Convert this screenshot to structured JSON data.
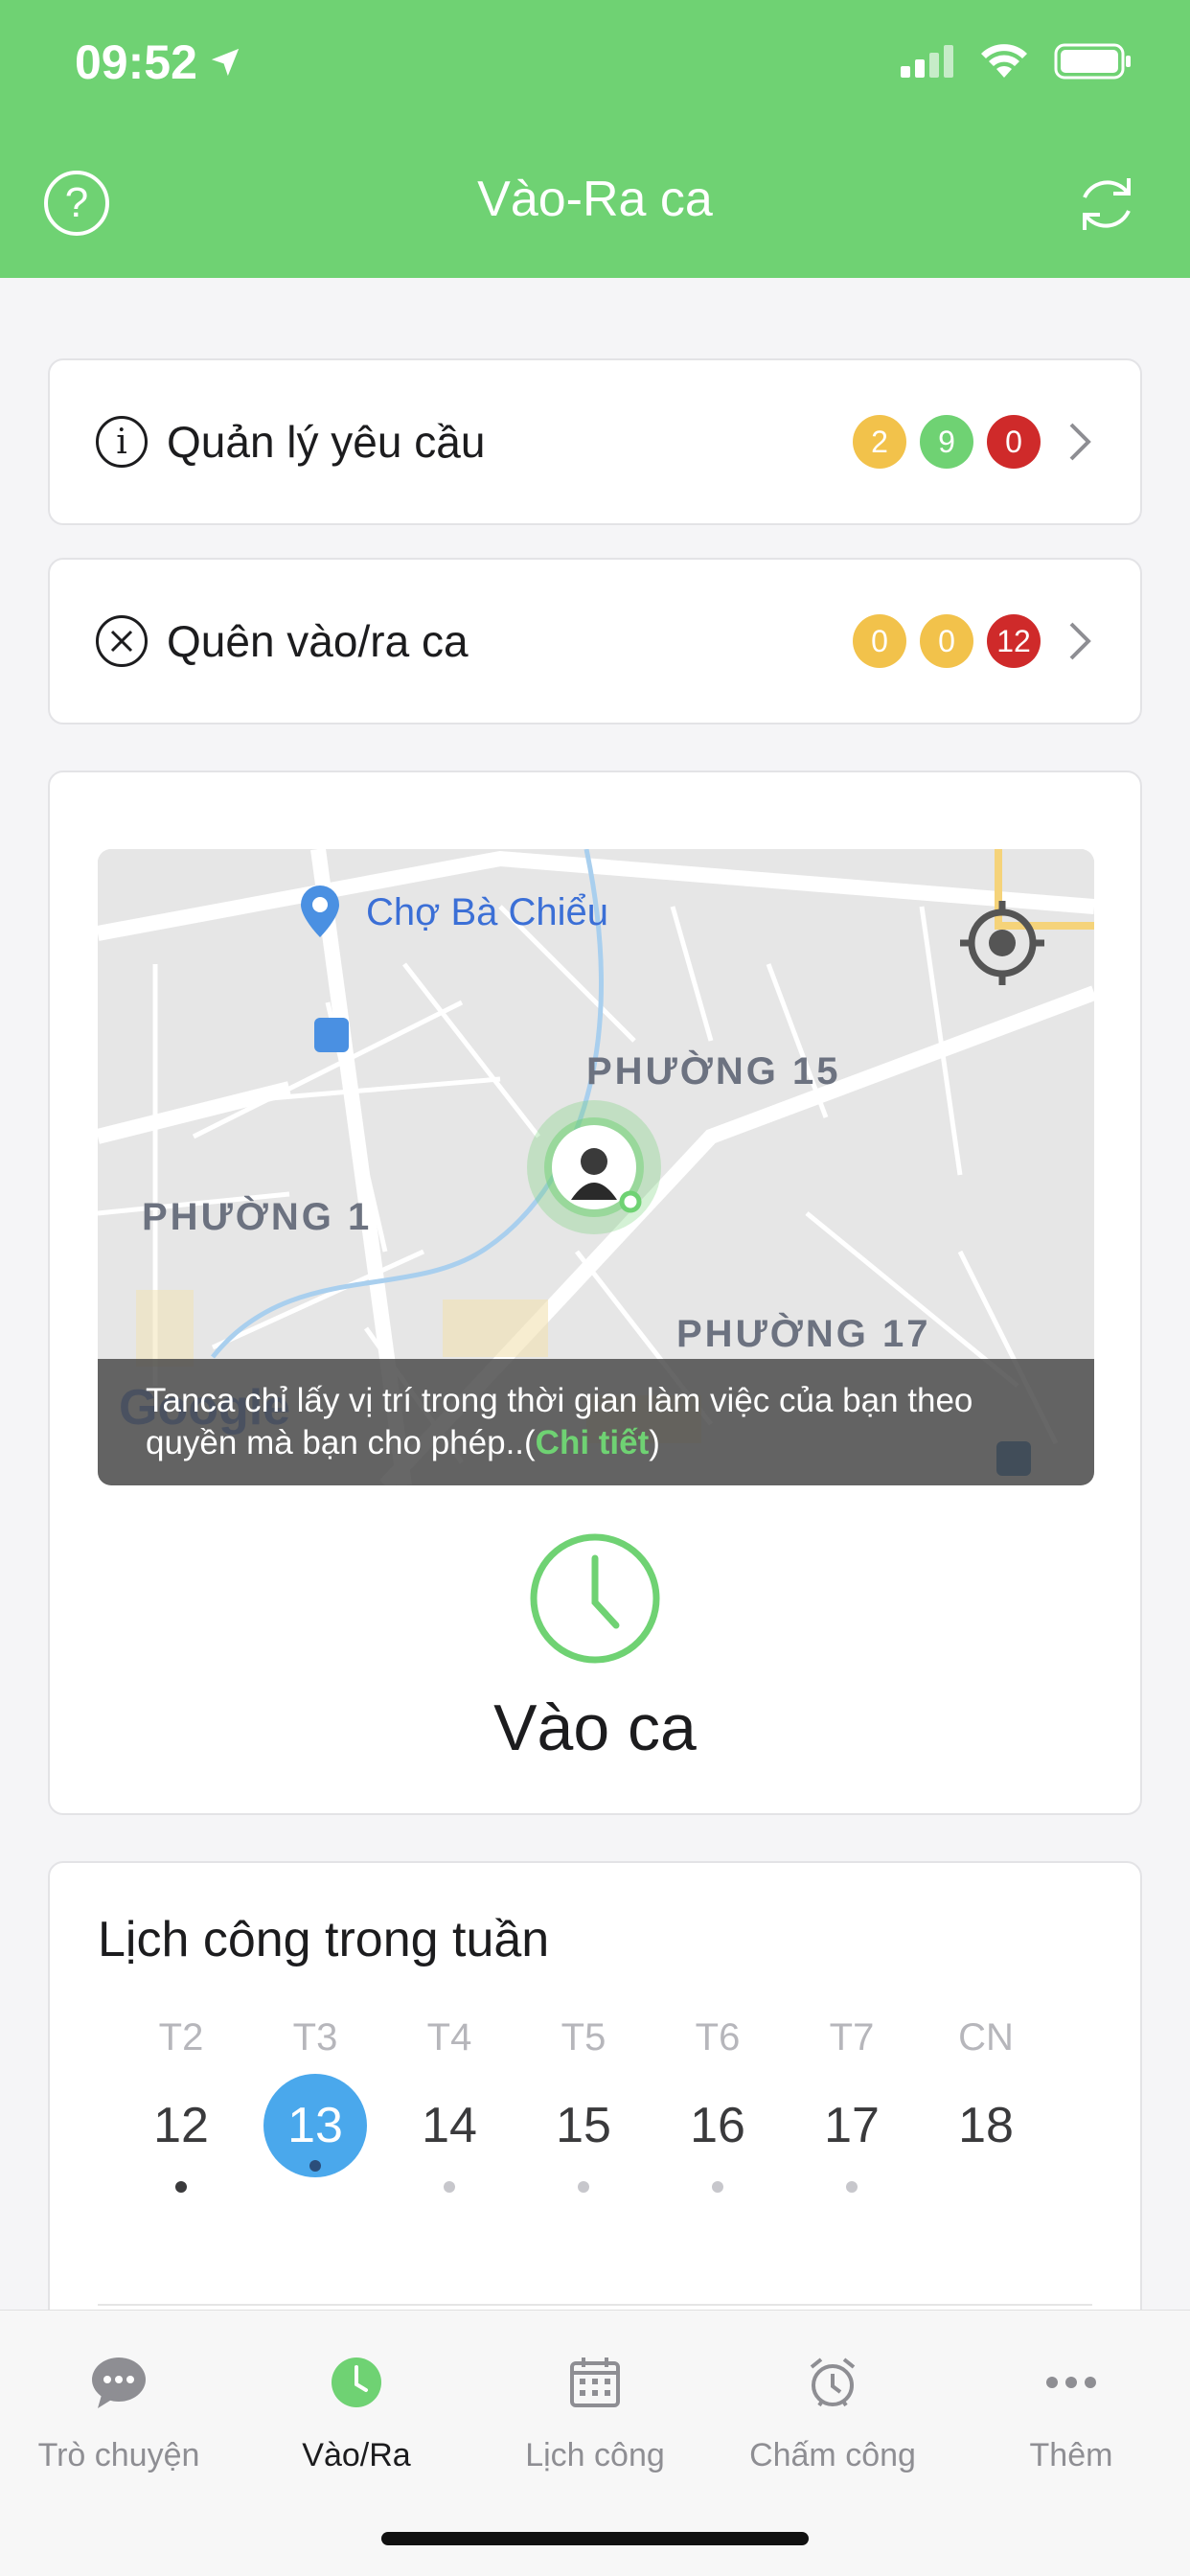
{
  "status_bar": {
    "time": "09:52"
  },
  "header": {
    "title": "Vào-Ra ca"
  },
  "requests": {
    "label": "Quản lý yêu cầu",
    "badges": [
      "2",
      "9",
      "0"
    ]
  },
  "forgot": {
    "label": "Quên vào/ra ca",
    "badges": [
      "0",
      "0",
      "12"
    ]
  },
  "map": {
    "places": {
      "market": "Chợ Bà Chiểu",
      "ward15": "PHƯỜNG 15",
      "ward1": "PHƯỜNG 1",
      "ward17": "PHƯỜNG 17"
    },
    "notice_text": "Tanca chỉ lấy vị trí trong thời gian làm việc của bạn theo quyền mà bạn cho phép..(",
    "notice_link": "Chi tiết",
    "notice_close": ")"
  },
  "checkin": {
    "label": "Vào ca"
  },
  "week": {
    "title": "Lịch công trong tuần",
    "days": [
      {
        "name": "T2",
        "num": "12"
      },
      {
        "name": "T3",
        "num": "13"
      },
      {
        "name": "T4",
        "num": "14"
      },
      {
        "name": "T5",
        "num": "15"
      },
      {
        "name": "T6",
        "num": "16"
      },
      {
        "name": "T7",
        "num": "17"
      },
      {
        "name": "CN",
        "num": "18"
      }
    ]
  },
  "tabs": [
    {
      "label": "Trò chuyện",
      "icon": "chat-icon"
    },
    {
      "label": "Vào/Ra",
      "icon": "clock-icon"
    },
    {
      "label": "Lịch công",
      "icon": "calendar-icon"
    },
    {
      "label": "Chấm công",
      "icon": "alarm-icon"
    },
    {
      "label": "Thêm",
      "icon": "more-icon"
    }
  ],
  "colors": {
    "brand": "#6fd273",
    "badge_yellow": "#f2c24b",
    "badge_green": "#6fd273",
    "badge_red": "#cf2a2a",
    "selected_day": "#4aa8ec"
  }
}
